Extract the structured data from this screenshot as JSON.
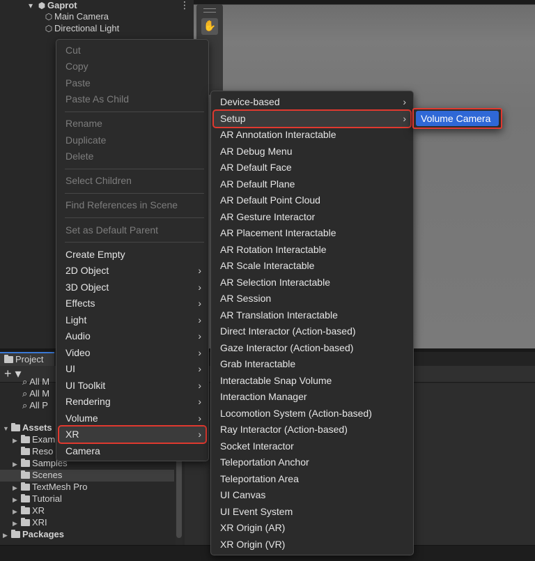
{
  "hierarchy": {
    "root": "Gaprot",
    "more_glyph": "⋮",
    "items": [
      "Main Camera",
      "Directional Light"
    ]
  },
  "project": {
    "tab_label": "Project",
    "add_glyph": "+ ▾",
    "favorites": [
      "All M",
      "All M",
      "All P"
    ],
    "assets_label": "Assets",
    "asset_folders": [
      "Exam",
      "Reso",
      "Samples",
      "Scenes",
      "TextMesh Pro",
      "Tutorial",
      "XR",
      "XRI"
    ],
    "packages_label": "Packages"
  },
  "context_menu": {
    "group1": [
      "Cut",
      "Copy",
      "Paste",
      "Paste As Child"
    ],
    "group2": [
      "Rename",
      "Duplicate",
      "Delete"
    ],
    "group3": [
      "Select Children"
    ],
    "group4": [
      "Find References in Scene"
    ],
    "group5": [
      "Set as Default Parent"
    ],
    "create_empty": "Create Empty",
    "submenus": [
      "2D Object",
      "3D Object",
      "Effects",
      "Light",
      "Audio",
      "Video",
      "UI",
      "UI Toolkit",
      "Rendering",
      "Volume",
      "XR"
    ],
    "camera": "Camera",
    "chevron": "›"
  },
  "xr_menu": {
    "items": [
      "Device-based",
      "Setup",
      "AR Annotation Interactable",
      "AR Debug Menu",
      "AR Default Face",
      "AR Default Plane",
      "AR Default Point Cloud",
      "AR Gesture Interactor",
      "AR Placement Interactable",
      "AR Rotation Interactable",
      "AR Scale Interactable",
      "AR Selection Interactable",
      "AR Session",
      "AR Translation Interactable",
      "Direct Interactor (Action-based)",
      "Gaze Interactor (Action-based)",
      "Grab Interactable",
      "Interactable Snap Volume",
      "Interaction Manager",
      "Locomotion System (Action-based)",
      "Ray Interactor (Action-based)",
      "Socket Interactor",
      "Teleportation Anchor",
      "Teleportation Area",
      "UI Canvas",
      "UI Event System",
      "XR Origin (AR)",
      "XR Origin (VR)"
    ]
  },
  "setup_menu": {
    "items": [
      "Volume Camera"
    ]
  },
  "colors": {
    "highlight_box": "#e0392f",
    "selection_blue": "#2f68d6"
  }
}
